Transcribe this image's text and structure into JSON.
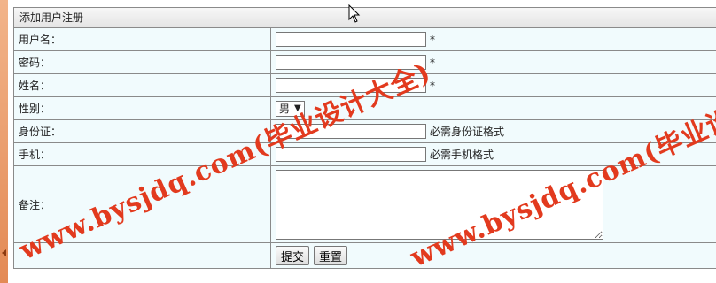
{
  "form": {
    "title": "添加用户注册",
    "fields": {
      "username": {
        "label": "用户名：",
        "value": "",
        "required_mark": "*"
      },
      "password": {
        "label": "密码：",
        "value": "",
        "required_mark": "*"
      },
      "name": {
        "label": "姓名：",
        "value": "",
        "required_mark": "*"
      },
      "gender": {
        "label": "性别：",
        "selected": "男"
      },
      "id_card": {
        "label": "身份证：",
        "value": "",
        "hint": "必需身份证格式"
      },
      "phone": {
        "label": "手机：",
        "value": "",
        "hint": "必需手机格式"
      },
      "remark": {
        "label": "备注：",
        "value": ""
      }
    },
    "buttons": {
      "submit": "提交",
      "reset": "重置"
    }
  },
  "watermark": {
    "line1": "www.bysjdq.com(毕业设计大全)",
    "line2": "www.bysjdq.com(毕业设计大"
  },
  "colors": {
    "watermark": "#e23a1e",
    "row_bg": "#f1fbfd",
    "border": "#8a8a8a"
  }
}
